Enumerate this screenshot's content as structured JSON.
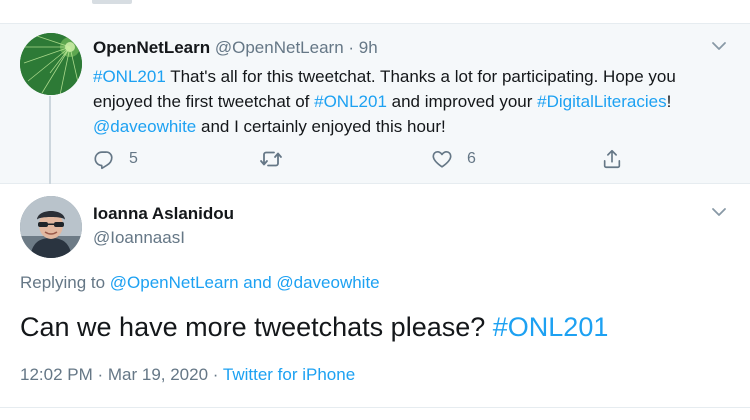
{
  "colors": {
    "link": "#1da1f2",
    "secondary_text": "#657786",
    "primary_text": "#14171a",
    "parent_background": "#f5f8fa",
    "divider": "#e6ecf0"
  },
  "parent_tweet": {
    "author_name": "OpenNetLearn",
    "author_handle": "@OpenNetLearn",
    "separator": "·",
    "time": "9h",
    "avatar_icon": "green-network-avatar",
    "text": {
      "hashtag1": "#ONL201",
      "part1": " That's all for this tweetchat. Thanks a lot for participating. Hope you enjoyed the first tweetchat of ",
      "hashtag2": "#ONL201",
      "part2": " and improved your ",
      "hashtag3": "#DigitalLiteracies",
      "part3": "! ",
      "mention": "@daveowhite",
      "part4": " and I certainly enjoyed this hour!"
    },
    "actions": {
      "reply_icon": "reply-icon",
      "reply_count": "5",
      "retweet_icon": "retweet-icon",
      "like_icon": "heart-icon",
      "like_count": "6",
      "share_icon": "share-icon"
    },
    "menu_icon": "chevron-down-icon"
  },
  "reply_tweet": {
    "author_name": "Ioanna Aslanidou",
    "author_handle": "@IoannaasI",
    "avatar_icon": "user-photo-avatar",
    "menu_icon": "chevron-down-icon",
    "replying_prefix": "Replying to ",
    "replying_user1": "@OpenNetLearn",
    "replying_and": " and ",
    "replying_user2": "@daveowhite",
    "text": "Can we have more tweetchats please? ",
    "hashtag": "#ONL201",
    "time": "12:02 PM",
    "separator1": " · ",
    "date": "Mar 19, 2020",
    "separator2": " · ",
    "source": "Twitter for iPhone"
  }
}
